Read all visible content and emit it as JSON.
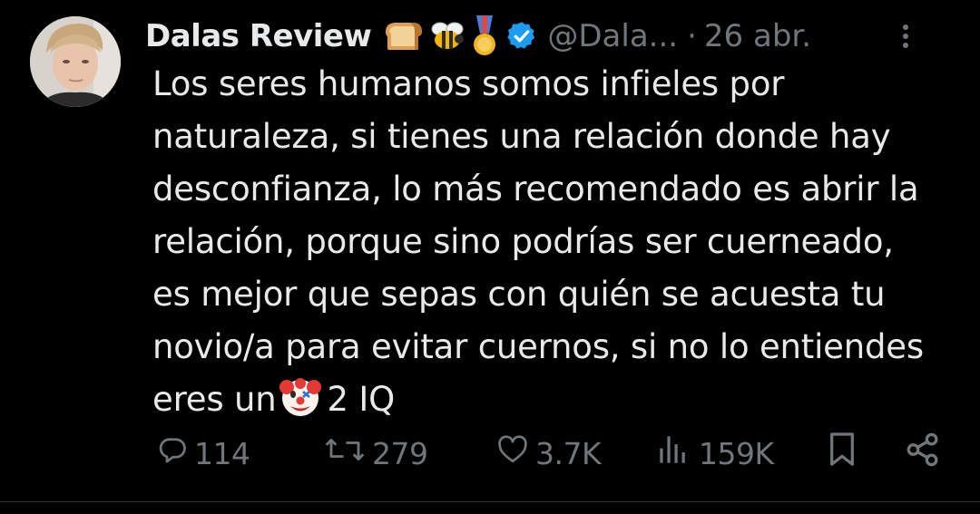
{
  "tweet": {
    "display_name": "Dalas Review",
    "handle": "@Dala...",
    "separator": "·",
    "date": "26 abr.",
    "badges": [
      "bread-icon",
      "bee-icon",
      "medal-icon"
    ],
    "verified_color": "#1d9bf0",
    "text_lines": [
      "Los seres humanos somos infieles por",
      "naturaleza, si tienes una relación donde hay",
      "desconfianza, lo más recomendado es abrir la",
      "relación, porque sino podrías ser cuerneado,",
      "es mejor que sepas con quién se acuesta tu",
      "novio/a para evitar cuernos, si no lo entiendes"
    ],
    "last_line_before_emoji": "eres un",
    "last_line_after_emoji": "2 IQ",
    "emoji": "clown-face-icon"
  },
  "actions": {
    "replies": "114",
    "reposts": "279",
    "likes": "3.7K",
    "views": "159K"
  },
  "colors": {
    "background": "#000000",
    "text": "#e7e9ea",
    "muted": "#71767b",
    "divider": "#2f3336"
  }
}
